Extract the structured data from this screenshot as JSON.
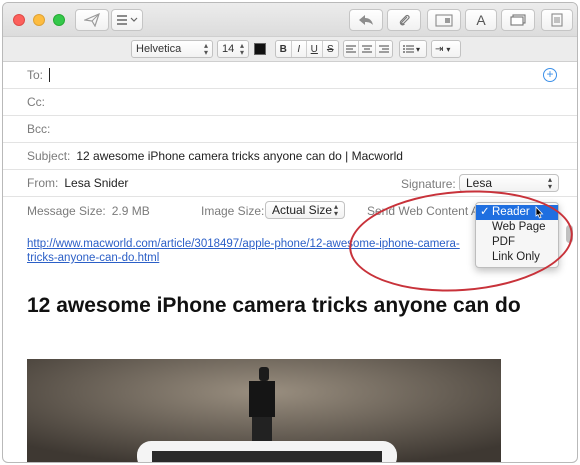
{
  "toolbar": {
    "send": "send-icon",
    "list": "list-icon",
    "reply": "reply-icon",
    "attach": "paperclip-icon",
    "photo": "photo-browser-icon",
    "fonts": "A",
    "window": "window-icon",
    "stationery": "stationery-icon"
  },
  "format": {
    "font": "Helvetica",
    "size": "14",
    "color": "#111111",
    "bold": "B",
    "italic": "I",
    "underline": "U",
    "strike": "S"
  },
  "header": {
    "to_label": "To:",
    "cc_label": "Cc:",
    "bcc_label": "Bcc:",
    "subject_label": "Subject:",
    "subject_value": "12 awesome iPhone camera tricks anyone can do | Macworld",
    "from_label": "From:",
    "from_value": "Lesa Snider",
    "signature_label": "Signature:",
    "signature_value": "Lesa"
  },
  "meta": {
    "message_size_label": "Message Size:",
    "message_size_value": "2.9 MB",
    "image_size_label": "Image Size:",
    "image_size_value": "Actual Size",
    "send_web_label": "Send Web Content As"
  },
  "menu": {
    "items": [
      {
        "label": "Reader",
        "selected": true
      },
      {
        "label": "Web Page",
        "selected": false
      },
      {
        "label": "PDF",
        "selected": false
      },
      {
        "label": "Link Only",
        "selected": false
      }
    ]
  },
  "body": {
    "link": "http://www.macworld.com/article/3018497/apple-phone/12-awesome-iphone-camera-tricks-anyone-can-do.html",
    "headline": "12 awesome iPhone camera tricks anyone can do"
  },
  "colors": {
    "accent": "#1f6fe0",
    "link": "#2b5fc7",
    "annotation": "#c8323a"
  }
}
